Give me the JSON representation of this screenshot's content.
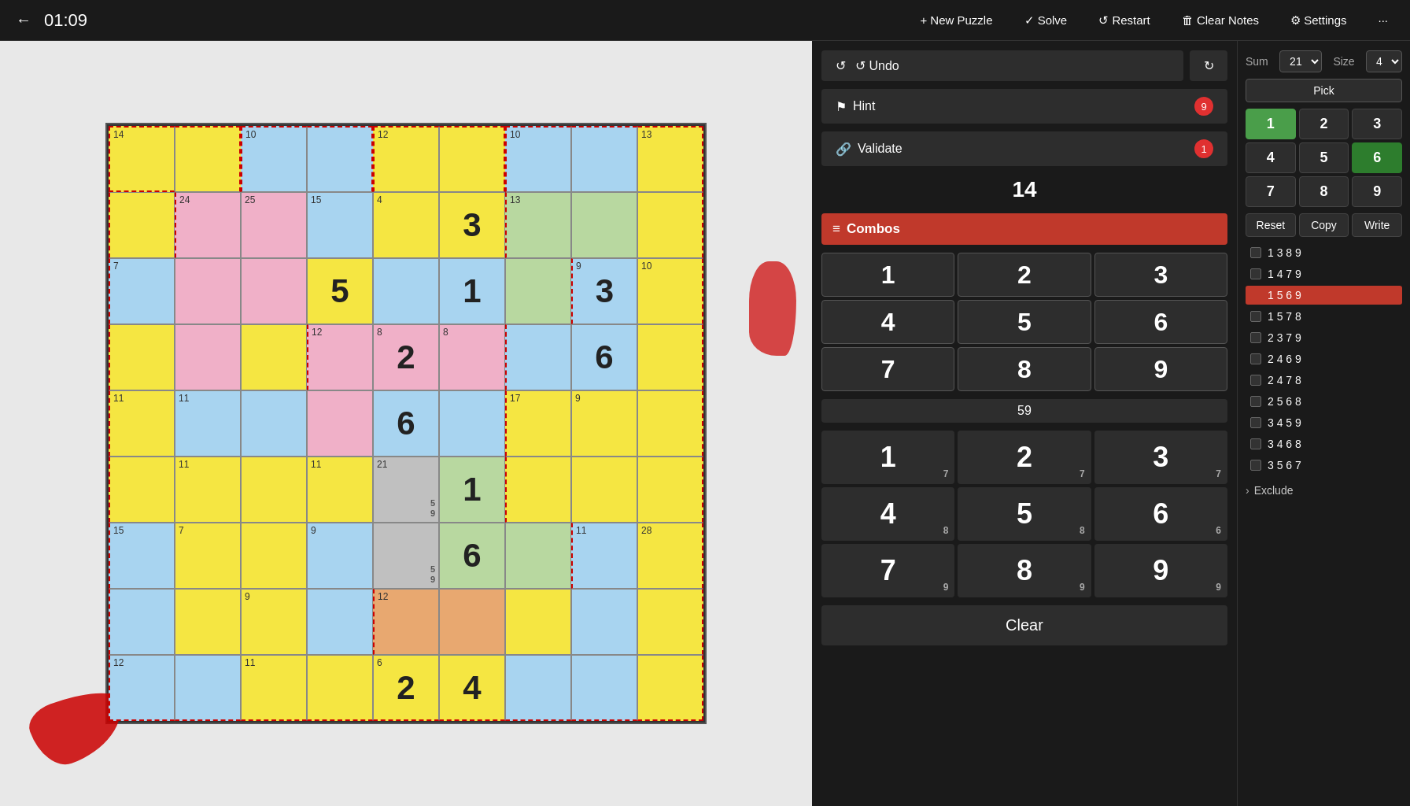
{
  "topbar": {
    "back_icon": "←",
    "timer": "01:09",
    "new_puzzle_label": "+ New Puzzle",
    "solve_label": "✓ Solve",
    "restart_label": "↺ Restart",
    "clear_notes_label": "🗑 Clear Notes",
    "settings_label": "⚙ Settings",
    "more_label": "···"
  },
  "controls": {
    "undo_label": "↺ Undo",
    "redo_label": "↻",
    "hint_label": "⚑ Hint",
    "hint_count": "9",
    "validate_label": "🔗 Validate",
    "validate_count": "1",
    "sum_value": "14",
    "combos_label": "≡ Combos",
    "combos_sum": "59",
    "clear_label": "Clear"
  },
  "num_grid": {
    "cells": [
      {
        "value": "1"
      },
      {
        "value": "2"
      },
      {
        "value": "3"
      },
      {
        "value": "4"
      },
      {
        "value": "5"
      },
      {
        "value": "6"
      },
      {
        "value": "7"
      },
      {
        "value": "8"
      },
      {
        "value": "9"
      }
    ]
  },
  "input_pad": {
    "cells": [
      {
        "value": "1",
        "sub": "7"
      },
      {
        "value": "2",
        "sub": "7"
      },
      {
        "value": "3",
        "sub": "7"
      },
      {
        "value": "4",
        "sub": "8"
      },
      {
        "value": "5",
        "sub": "8"
      },
      {
        "value": "6",
        "sub": "6"
      },
      {
        "value": "7",
        "sub": "9"
      },
      {
        "value": "8",
        "sub": "9"
      },
      {
        "value": "9",
        "sub": "9"
      }
    ]
  },
  "far_right": {
    "sum_label": "Sum",
    "size_label": "Size",
    "sum_value": "21",
    "size_value": "4",
    "pick_label": "Pick",
    "numbers": [
      {
        "value": "1",
        "active": "green"
      },
      {
        "value": "2",
        "active": "none"
      },
      {
        "value": "3",
        "active": "none"
      },
      {
        "value": "4",
        "active": "none"
      },
      {
        "value": "5",
        "active": "none"
      },
      {
        "value": "6",
        "active": "green-dark"
      },
      {
        "value": "7",
        "active": "none"
      },
      {
        "value": "8",
        "active": "none"
      },
      {
        "value": "9",
        "active": "none"
      }
    ],
    "reset_label": "Reset",
    "copy_label": "Copy",
    "write_label": "Write",
    "combos": [
      {
        "digits": "1 3 8 9",
        "selected": false
      },
      {
        "digits": "1 4 7 9",
        "selected": false
      },
      {
        "digits": "1 5 6 9",
        "selected": true
      },
      {
        "digits": "1 5 7 8",
        "selected": false
      },
      {
        "digits": "2 3 7 9",
        "selected": false
      },
      {
        "digits": "2 4 6 9",
        "selected": false
      },
      {
        "digits": "2 4 7 8",
        "selected": false
      },
      {
        "digits": "2 5 6 8",
        "selected": false
      },
      {
        "digits": "3 4 5 9",
        "selected": false
      },
      {
        "digits": "3 4 6 8",
        "selected": false
      },
      {
        "digits": "3 5 6 7",
        "selected": false
      }
    ],
    "exclude_label": "Exclude"
  }
}
